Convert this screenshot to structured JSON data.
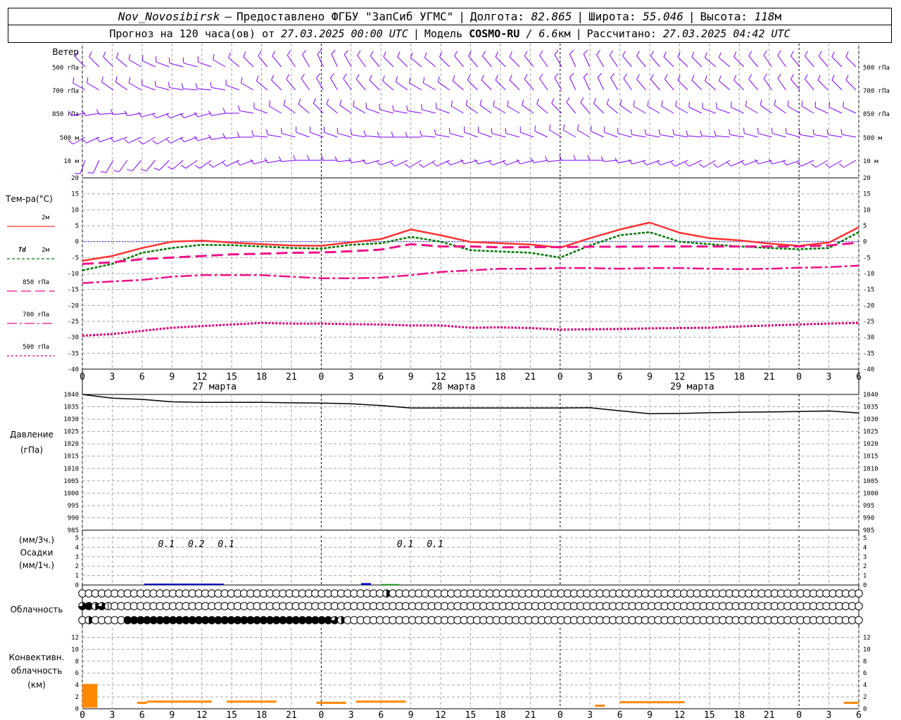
{
  "header": {
    "station": "Nov_Novosibirsk",
    "dash": "–",
    "provider": "Предоставлено ФГБУ \"ЗапСиб УГМС\"",
    "lon_label": "Долгота:",
    "lon": "82.865",
    "lat_label": "Широта:",
    "lat": "55.046",
    "alt_label": "Высота:",
    "alt": "118",
    "alt_unit": "м"
  },
  "subheader": {
    "forecast_label": "Прогноз на 120 часа(ов) от",
    "forecast_time": "27.03.2025 00:00 UTC",
    "model_label": "Модель",
    "model": "COSMO-RU",
    "resolution": "/ 6.6",
    "res_unit": "км",
    "calc_label": "Рассчитано:",
    "calc_time": "27.03.2025 04:42 UTC"
  },
  "colors": {
    "wind": "#8000ff",
    "t2m": "#ff3333",
    "td2m": "#007700",
    "t850": "#ee1188",
    "t700": "#ee1188",
    "t500": "#dd0077",
    "pressure": "#000000",
    "precip1": "#0000cc",
    "precip2": "#009900",
    "convective": "#ff8800",
    "grid": "#aaaaaa"
  },
  "x_axis": {
    "hour_ticks": [
      "0",
      "3",
      "6",
      "9",
      "12",
      "15",
      "18",
      "21",
      "0",
      "3",
      "6",
      "9",
      "12",
      "15",
      "18",
      "21",
      "0",
      "3",
      "6",
      "9",
      "12",
      "15",
      "18",
      "21",
      "0",
      "3",
      "6"
    ],
    "day_labels": [
      "27 марта",
      "28 марта",
      "29 марта"
    ]
  },
  "wind": {
    "title": "Ветер",
    "levels": [
      "500 гПа",
      "700 гПа",
      "850 гПа",
      "500 м",
      "10  м"
    ],
    "dir_500hpa": [
      315,
      315,
      315,
      310,
      300,
      295,
      290,
      285,
      285,
      290,
      300,
      310,
      315,
      320,
      320,
      325,
      330,
      335,
      335,
      330,
      325,
      320,
      315,
      315,
      310,
      310,
      315,
      320,
      320,
      320,
      315,
      315,
      320,
      325,
      330,
      335,
      335,
      330,
      325,
      320,
      320,
      320,
      315,
      315,
      315,
      310,
      310,
      315,
      320,
      325,
      325,
      320,
      320,
      320,
      315,
      315
    ],
    "dir_700hpa": [
      300,
      300,
      305,
      305,
      300,
      290,
      285,
      280,
      275,
      275,
      280,
      290,
      300,
      310,
      315,
      320,
      325,
      330,
      330,
      325,
      320,
      315,
      310,
      305,
      300,
      300,
      305,
      310,
      315,
      315,
      315,
      315,
      320,
      325,
      330,
      335,
      335,
      335,
      330,
      325,
      320,
      320,
      320,
      315,
      315,
      310,
      310,
      315,
      320,
      325,
      325,
      320,
      320,
      315,
      315,
      315
    ],
    "dir_850hpa": [
      260,
      260,
      265,
      265,
      260,
      255,
      250,
      250,
      250,
      255,
      260,
      270,
      280,
      290,
      300,
      305,
      310,
      315,
      310,
      305,
      300,
      290,
      285,
      280,
      280,
      285,
      290,
      300,
      305,
      305,
      300,
      300,
      305,
      310,
      315,
      320,
      320,
      315,
      310,
      305,
      300,
      300,
      300,
      300,
      295,
      290,
      290,
      295,
      300,
      305,
      305,
      300,
      300,
      295,
      295,
      295
    ],
    "dir_500m": [
      240,
      245,
      250,
      250,
      245,
      240,
      240,
      245,
      250,
      255,
      260,
      265,
      270,
      275,
      280,
      285,
      290,
      290,
      290,
      285,
      280,
      275,
      270,
      270,
      270,
      275,
      280,
      285,
      290,
      290,
      285,
      285,
      290,
      295,
      300,
      300,
      300,
      295,
      290,
      285,
      280,
      280,
      280,
      280,
      275,
      275,
      275,
      280,
      285,
      285,
      285,
      285,
      280,
      280,
      280,
      280
    ],
    "dir_10m": [
      200,
      205,
      210,
      215,
      220,
      220,
      225,
      230,
      235,
      235,
      240,
      245,
      250,
      255,
      260,
      265,
      270,
      270,
      270,
      265,
      260,
      255,
      250,
      245,
      240,
      240,
      245,
      250,
      255,
      255,
      250,
      250,
      255,
      260,
      265,
      270,
      270,
      270,
      265,
      260,
      255,
      250,
      250,
      245,
      245,
      240,
      240,
      245,
      250,
      255,
      255,
      250,
      245,
      240,
      240,
      240
    ]
  },
  "temp_panel": {
    "title": "Тем-ра(°С)",
    "legend": [
      {
        "label": "2м",
        "key": "t2m",
        "dash": ""
      },
      {
        "label": "2м",
        "prefix": "Td",
        "key": "td2m",
        "dash": "4,3"
      },
      {
        "label": "850 гПа",
        "key": "t850",
        "dash": "14,6"
      },
      {
        "label": "700 гПа",
        "key": "t700",
        "dash": "14,4,3,4"
      },
      {
        "label": "500 гПа",
        "key": "t500",
        "dash": "3,3"
      }
    ],
    "y_ticks": [
      "20",
      "15",
      "10",
      "5",
      "0",
      "-5",
      "-10",
      "-15",
      "-20",
      "-25",
      "-30",
      "-35",
      "-40"
    ]
  },
  "pressure_panel": {
    "title1": "Давление",
    "title2": "(гПа)",
    "y_ticks": [
      "1040",
      "1035",
      "1030",
      "1025",
      "1020",
      "1015",
      "1010",
      "1005",
      "1000",
      "995",
      "990",
      "985"
    ]
  },
  "precip_panel": {
    "title1": "(мм/3ч.)",
    "title2": "Осадки",
    "title3": "(мм/1ч.)",
    "y_ticks": [
      "5",
      "4",
      "3",
      "2",
      "1",
      "0"
    ],
    "labels": [
      {
        "h": 9,
        "text": "0.1"
      },
      {
        "h": 12,
        "text": "0.2"
      },
      {
        "h": 15,
        "text": "0.1"
      },
      {
        "h": 33,
        "text": "0.1"
      },
      {
        "h": 36,
        "text": "0.1"
      }
    ]
  },
  "cloud_panel": {
    "title": "Облачность",
    "rows": {
      "high": [
        0,
        0,
        0,
        0,
        0,
        0,
        0,
        0,
        0,
        0,
        0,
        0,
        0,
        0,
        0,
        0,
        0,
        0,
        0,
        0,
        0,
        0,
        0,
        0,
        0,
        0,
        0,
        0,
        0,
        0,
        0,
        0,
        0,
        0,
        0,
        0,
        0,
        0,
        0,
        0,
        0,
        0,
        0,
        0,
        0,
        0,
        0,
        2,
        0,
        0,
        0,
        0,
        0,
        0,
        0,
        0,
        0,
        0,
        0,
        0,
        0,
        0,
        0,
        0,
        0,
        0,
        0,
        0,
        0,
        0,
        0,
        0,
        0,
        0,
        0,
        0,
        0,
        0,
        0,
        0,
        0,
        0,
        0,
        0,
        0,
        0,
        0,
        0,
        0,
        0,
        0,
        0,
        0,
        0,
        0,
        0,
        0,
        0,
        0,
        0,
        0,
        0,
        0,
        0,
        0,
        0,
        0,
        0,
        0,
        0,
        0,
        0,
        0,
        0,
        0,
        0,
        0,
        0,
        0,
        0,
        0
      ],
      "mid": [
        3,
        4,
        2,
        3,
        1,
        0,
        0,
        0,
        0,
        0,
        0,
        0,
        0,
        0,
        0,
        0,
        0,
        0,
        0,
        0,
        0,
        0,
        0,
        0,
        0,
        0,
        0,
        0,
        0,
        0,
        0,
        0,
        0,
        0,
        0,
        0,
        0,
        0,
        0,
        0,
        0,
        0,
        0,
        0,
        0,
        0,
        0,
        0,
        0,
        0,
        0,
        0,
        0,
        0,
        0,
        0,
        0,
        0,
        0,
        0,
        0,
        0,
        0,
        0,
        0,
        0,
        0,
        0,
        0,
        0,
        0,
        0,
        0,
        0,
        0,
        0,
        0,
        0,
        0,
        0,
        0,
        0,
        0,
        0,
        0,
        0,
        0,
        0,
        0,
        0,
        0,
        0,
        0,
        0,
        0,
        0,
        0,
        0,
        0,
        0,
        0,
        0,
        0,
        0,
        0,
        0,
        0,
        0,
        0,
        0,
        0,
        0,
        0,
        0,
        0,
        0,
        0,
        0,
        0,
        0,
        0
      ],
      "low": [
        0,
        2,
        0,
        0,
        0,
        0,
        0,
        4,
        4,
        4,
        4,
        4,
        4,
        4,
        4,
        4,
        4,
        4,
        4,
        4,
        4,
        4,
        4,
        4,
        4,
        4,
        4,
        4,
        4,
        4,
        4,
        4,
        4,
        4,
        4,
        4,
        4,
        4,
        4,
        3,
        2,
        0,
        0,
        0,
        0,
        0,
        0,
        0,
        0,
        0,
        0,
        0,
        0,
        0,
        0,
        0,
        0,
        0,
        0,
        0,
        0,
        0,
        0,
        0,
        0,
        0,
        0,
        0,
        0,
        0,
        0,
        0,
        0,
        0,
        0,
        0,
        0,
        0,
        0,
        0,
        0,
        0,
        0,
        0,
        0,
        0,
        0,
        0,
        0,
        0,
        0,
        0,
        0,
        0,
        0,
        0,
        0,
        0,
        0,
        0,
        0,
        0,
        0,
        0,
        0,
        0,
        0,
        0,
        0,
        0,
        0,
        0,
        0,
        0,
        0,
        0,
        0,
        0,
        0,
        0,
        0
      ]
    }
  },
  "conv_panel": {
    "title1": "Конвективн.",
    "title2": "облачность",
    "title3": "(км)",
    "y_ticks": [
      "12",
      "10",
      "8",
      "6",
      "4",
      "2",
      "0"
    ]
  },
  "chart_data": [
    {
      "type": "line",
      "name": "temperature",
      "x_hours": [
        0,
        3,
        6,
        9,
        12,
        15,
        18,
        21,
        24,
        27,
        30,
        33,
        36,
        39,
        42,
        45,
        48,
        51,
        54,
        57,
        60,
        63,
        66,
        69,
        72,
        75,
        78
      ],
      "series": [
        {
          "key": "t2m",
          "values": [
            -6,
            -4.5,
            -2,
            0,
            0.3,
            -0.3,
            -0.8,
            -1.2,
            -1.3,
            -0.2,
            0.8,
            3.8,
            2,
            -0.1,
            -0.5,
            -0.9,
            -1.9,
            1.1,
            3.8,
            6,
            2.8,
            1.1,
            0.4,
            -0.6,
            -1.3,
            -0.3,
            4.5
          ]
        },
        {
          "key": "td2m",
          "values": [
            -9,
            -7,
            -3.5,
            -2,
            -1,
            -1.1,
            -1.5,
            -2,
            -2.2,
            -1,
            -0.5,
            1.5,
            0,
            -2.7,
            -3.1,
            -3.5,
            -5,
            -1.2,
            2,
            3,
            0,
            -0.8,
            -1.5,
            -2,
            -2.4,
            -2,
            3
          ]
        },
        {
          "key": "t850",
          "values": [
            -7,
            -6.5,
            -5.5,
            -5,
            -4.5,
            -4,
            -3.8,
            -3.5,
            -3.4,
            -3,
            -2.5,
            -0.8,
            -1.5,
            -1.5,
            -1.8,
            -1.7,
            -1.7,
            -1.6,
            -1.6,
            -1.5,
            -1.5,
            -1.5,
            -1.5,
            -1.5,
            -1.5,
            -1.2,
            -0.3
          ]
        },
        {
          "key": "t700",
          "values": [
            -13,
            -12.5,
            -12,
            -11,
            -10.5,
            -10.5,
            -10.5,
            -11,
            -11.5,
            -11.5,
            -11.3,
            -10.5,
            -9.5,
            -9,
            -8.5,
            -8.5,
            -8.3,
            -8.3,
            -8.5,
            -8.3,
            -8.3,
            -8.5,
            -8.6,
            -8.5,
            -8.2,
            -8,
            -7.5
          ]
        },
        {
          "key": "t500",
          "values": [
            -29.5,
            -29,
            -28,
            -27,
            -26.5,
            -26,
            -25.5,
            -25.7,
            -25.7,
            -25.9,
            -26,
            -26.3,
            -26.3,
            -27,
            -26.9,
            -27.1,
            -27.6,
            -27.5,
            -27.4,
            -27.2,
            -27.1,
            -27,
            -26.6,
            -26.3,
            -26,
            -25.7,
            -25.5
          ]
        }
      ],
      "ylim": [
        -40,
        20
      ]
    },
    {
      "type": "line",
      "name": "pressure",
      "x_hours": [
        0,
        3,
        6,
        9,
        12,
        15,
        18,
        21,
        24,
        27,
        30,
        33,
        36,
        39,
        42,
        45,
        48,
        51,
        54,
        57,
        60,
        63,
        66,
        69,
        72,
        75,
        78
      ],
      "series": [
        {
          "key": "pressure",
          "values": [
            1040,
            1038.5,
            1038,
            1037,
            1036.8,
            1036.8,
            1036.8,
            1036.6,
            1036.5,
            1036.2,
            1035.5,
            1034.5,
            1034.5,
            1034.5,
            1034.5,
            1034.5,
            1034.5,
            1034.6,
            1033.4,
            1032.2,
            1032.3,
            1032.6,
            1032.8,
            1032.9,
            1033.1,
            1033.3,
            1032.5
          ]
        }
      ],
      "ylim": [
        985,
        1040
      ]
    },
    {
      "type": "bar",
      "name": "precipitation",
      "segments": [
        {
          "from": 6.2,
          "to": 14.2,
          "value": 0.15,
          "color_key": "precip1"
        },
        {
          "from": 28,
          "to": 29,
          "value": 0.2,
          "color_key": "precip1"
        },
        {
          "from": 30,
          "to": 31.8,
          "value": 0.1,
          "color_key": "precip2"
        }
      ],
      "ylim": [
        0,
        5
      ]
    },
    {
      "type": "bar",
      "name": "convective",
      "segments": [
        {
          "from": 0,
          "to": 1.5,
          "value": 4,
          "color_key": "convective"
        },
        {
          "from": 5.5,
          "to": 6.5,
          "value": 1,
          "color_key": "convective"
        },
        {
          "from": 6.5,
          "to": 11.5,
          "value": 1.2,
          "color_key": "convective"
        },
        {
          "from": 11.5,
          "to": 13,
          "value": 1.2,
          "color_key": "convective"
        },
        {
          "from": 14.5,
          "to": 19.5,
          "value": 1.2,
          "color_key": "convective"
        },
        {
          "from": 23.5,
          "to": 26.5,
          "value": 1,
          "color_key": "convective"
        },
        {
          "from": 27.5,
          "to": 32.5,
          "value": 1.2,
          "color_key": "convective"
        },
        {
          "from": 51.5,
          "to": 52.5,
          "value": 0.5,
          "color_key": "convective"
        },
        {
          "from": 54,
          "to": 60.5,
          "value": 1.1,
          "color_key": "convective"
        },
        {
          "from": 76.5,
          "to": 78,
          "value": 1,
          "color_key": "convective"
        }
      ],
      "ylim": [
        0,
        13
      ]
    }
  ]
}
